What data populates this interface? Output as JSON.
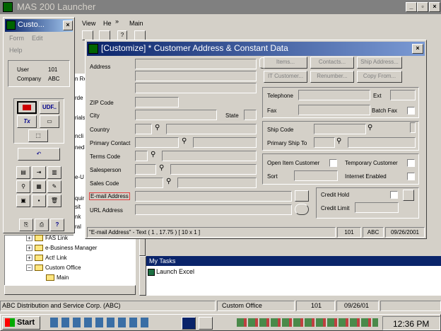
{
  "app": {
    "title": "MAS 200 Launcher"
  },
  "launcher_menu": {
    "view": "View",
    "help": "He",
    "more": "»",
    "main": "Main"
  },
  "customize_panel": {
    "title": "Custo...",
    "menu": {
      "form": "Form",
      "edit": "Edit",
      "help": "Help"
    },
    "user_label": "User",
    "user_value": "101",
    "company_label": "Company",
    "company_value": "ABC",
    "udf_label": "UDF..",
    "tx_label": "Tx"
  },
  "background_list": [
    "n Re",
    "rde",
    "rials",
    "ncli",
    "nedi",
    "e-U",
    "quir",
    "sit",
    "nk",
    "ral"
  ],
  "tree": [
    {
      "label": "FAS Link",
      "type": "plus"
    },
    {
      "label": "e-Business Manager",
      "type": "plus"
    },
    {
      "label": "Act! Link",
      "type": "plus"
    },
    {
      "label": "Custom Office",
      "type": "minus"
    },
    {
      "label": "Main",
      "type": "child"
    }
  ],
  "dialog": {
    "title": "[Customize] * Customer Address & Constant Data",
    "labels": {
      "address": "Address",
      "zip": "ZIP Code",
      "city": "City",
      "state": "State",
      "country": "Country",
      "primary_contact": "Primary Contact",
      "terms_code": "Terms Code",
      "salesperson": "Salesperson",
      "sales_code": "Sales Code",
      "email": "E-mail Address",
      "url": "URL Address",
      "telephone": "Telephone",
      "ext": "Ext",
      "fax": "Fax",
      "batch_fax": "Batch Fax",
      "ship_code": "Ship Code",
      "primary_ship_to": "Primary Ship To",
      "open_item": "Open Item Customer",
      "temporary": "Temporary Customer",
      "sort": "Sort",
      "internet_enabled": "Internet Enabled",
      "credit_hold": "Credit Hold",
      "credit_limit": "Credit Limit"
    },
    "buttons": {
      "items": "Items...",
      "contacts": "Contacts...",
      "ship_address": "Ship Address...",
      "it_customer": "IT Customer...",
      "renumber": "Renumber...",
      "copy_from": "Copy From..."
    },
    "status": {
      "field_info": "\"E-mail Address\" - Text ( 1 , 17.75 ) [ 10 x 1 ]",
      "user": "101",
      "company": "ABC",
      "date": "09/26/2001"
    }
  },
  "my_tasks": {
    "title": "My Tasks",
    "item": "Launch Excel"
  },
  "statusbar": {
    "company": "ABC Distribution and Service Corp. (ABC)",
    "module": "Custom Office",
    "user": "101",
    "date": "09/26/01"
  },
  "taskbar": {
    "start": "Start",
    "clock": "12:36 PM"
  }
}
